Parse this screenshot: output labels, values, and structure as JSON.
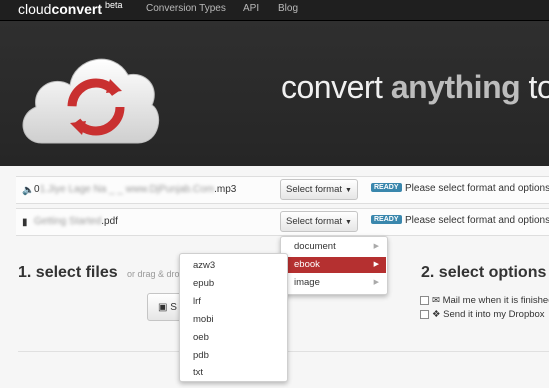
{
  "navbar": {
    "brand_light": "cloud",
    "brand_bold": "convert",
    "brand_beta": "beta",
    "links": [
      "Conversion Types",
      "API",
      "Blog"
    ]
  },
  "hero": {
    "text_prefix": "convert ",
    "text_emphasis": "anything",
    "text_suffix": " to"
  },
  "files": [
    {
      "icon": "audio-file-icon",
      "name_prefix": "0",
      "name_blurred": "1.Jiye Lage Na _ _ www.DjPunjab.Com",
      "name_ext": ".mp3",
      "select_label": "Select format",
      "status_badge": "READY",
      "status_text": "Please select format and options"
    },
    {
      "icon": "document-file-icon",
      "name_prefix": "",
      "name_blurred": "Getting Started",
      "name_ext": ".pdf",
      "select_label": "Select format",
      "status_badge": "READY",
      "status_text": "Please select format and options"
    }
  ],
  "section_select": {
    "heading": "1. select files",
    "sub": "or drag & dro"
  },
  "start_button": {
    "label": "S"
  },
  "section_options": {
    "heading": "2. select options",
    "opt_mail": "Mail me when it is finished",
    "opt_dropbox": "Send it into my Dropbox"
  },
  "format_menu": {
    "items": [
      "document",
      "ebook",
      "image"
    ],
    "active": "ebook"
  },
  "ebook_submenu": {
    "items": [
      "azw3",
      "epub",
      "lrf",
      "mobi",
      "oeb",
      "pdb",
      "txt"
    ]
  },
  "colors": {
    "active_menu": "#b53030",
    "ready_badge": "#3a87ad",
    "brand_red": "#c93030"
  }
}
